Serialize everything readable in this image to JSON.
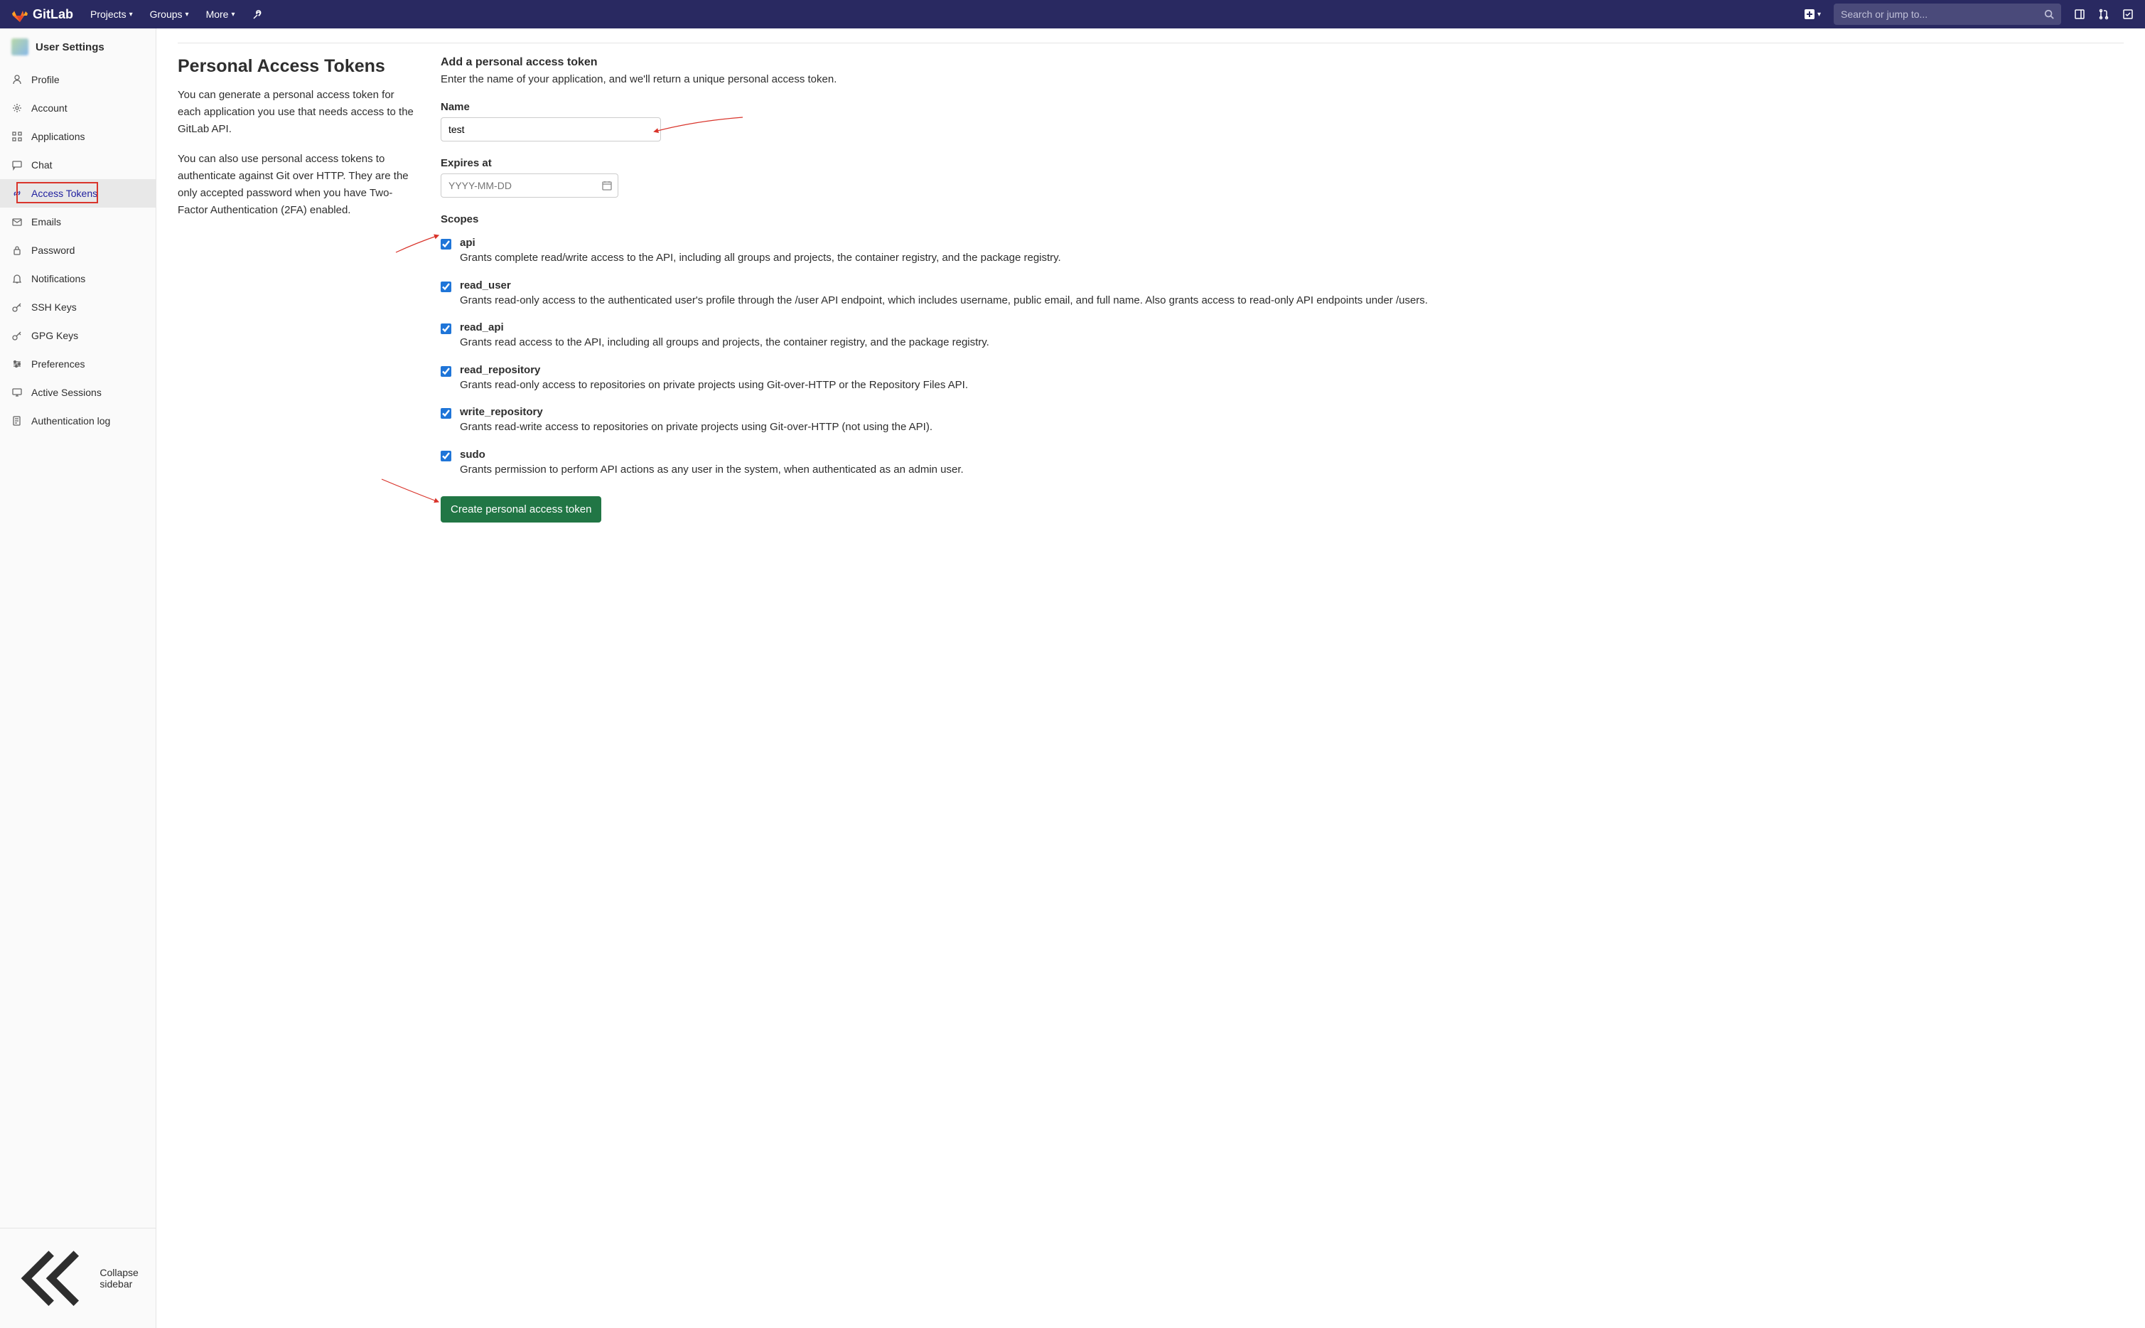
{
  "navbar": {
    "brand": "GitLab",
    "items": [
      "Projects",
      "Groups",
      "More"
    ],
    "search_placeholder": "Search or jump to..."
  },
  "sidebar": {
    "title": "User Settings",
    "items": [
      {
        "icon": "user",
        "label": "Profile"
      },
      {
        "icon": "gear",
        "label": "Account"
      },
      {
        "icon": "apps",
        "label": "Applications"
      },
      {
        "icon": "chat",
        "label": "Chat"
      },
      {
        "icon": "link",
        "label": "Access Tokens",
        "active": true,
        "highlight": true
      },
      {
        "icon": "mail",
        "label": "Emails"
      },
      {
        "icon": "lock",
        "label": "Password"
      },
      {
        "icon": "bell",
        "label": "Notifications"
      },
      {
        "icon": "key",
        "label": "SSH Keys"
      },
      {
        "icon": "key",
        "label": "GPG Keys"
      },
      {
        "icon": "prefs",
        "label": "Preferences"
      },
      {
        "icon": "monitor",
        "label": "Active Sessions"
      },
      {
        "icon": "doc",
        "label": "Authentication log"
      }
    ],
    "collapse": "Collapse sidebar"
  },
  "main": {
    "title": "Personal Access Tokens",
    "desc1": "You can generate a personal access token for each application you use that needs access to the GitLab API.",
    "desc2": "You can also use personal access tokens to authenticate against Git over HTTP. They are the only accepted password when you have Two-Factor Authentication (2FA) enabled.",
    "form": {
      "heading": "Add a personal access token",
      "sub": "Enter the name of your application, and we'll return a unique personal access token.",
      "name_label": "Name",
      "name_value": "test",
      "expires_label": "Expires at",
      "expires_placeholder": "YYYY-MM-DD",
      "scopes_label": "Scopes",
      "scopes": [
        {
          "name": "api",
          "checked": true,
          "desc": "Grants complete read/write access to the API, including all groups and projects, the container registry, and the package registry."
        },
        {
          "name": "read_user",
          "checked": true,
          "desc": "Grants read-only access to the authenticated user's profile through the /user API endpoint, which includes username, public email, and full name. Also grants access to read-only API endpoints under /users."
        },
        {
          "name": "read_api",
          "checked": true,
          "desc": "Grants read access to the API, including all groups and projects, the container registry, and the package registry."
        },
        {
          "name": "read_repository",
          "checked": true,
          "desc": "Grants read-only access to repositories on private projects using Git-over-HTTP or the Repository Files API."
        },
        {
          "name": "write_repository",
          "checked": true,
          "desc": "Grants read-write access to repositories on private projects using Git-over-HTTP (not using the API)."
        },
        {
          "name": "sudo",
          "checked": true,
          "desc": "Grants permission to perform API actions as any user in the system, when authenticated as an admin user."
        }
      ],
      "submit": "Create personal access token"
    }
  }
}
